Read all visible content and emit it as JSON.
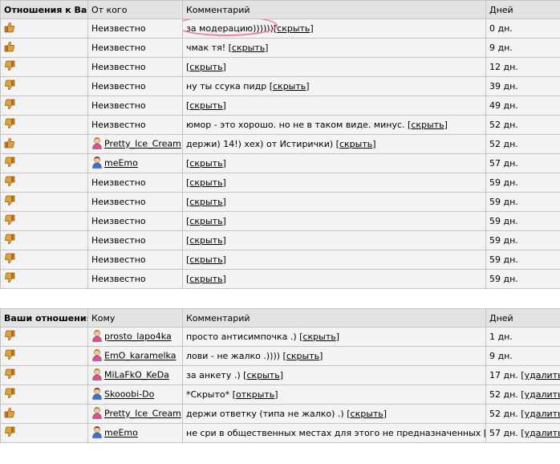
{
  "incoming": {
    "headers": [
      "Отношения к Вам",
      "От кого",
      "Комментарий",
      "Дней"
    ],
    "rows": [
      {
        "vote": "up",
        "from": "Неизвестно",
        "from_user": false,
        "comment": "за модерацию))))))",
        "action": "скрыть",
        "days": "0 дн.",
        "extra": ""
      },
      {
        "vote": "up",
        "from": "Неизвестно",
        "from_user": false,
        "comment": "чмак тя!",
        "action": "скрыть",
        "days": "9 дн.",
        "extra": ""
      },
      {
        "vote": "down",
        "from": "Неизвестно",
        "from_user": false,
        "comment": "",
        "action": "скрыть",
        "days": "12 дн.",
        "extra": ""
      },
      {
        "vote": "down",
        "from": "Неизвестно",
        "from_user": false,
        "comment": "ну ты ссука пидр",
        "action": "скрыть",
        "days": "39 дн.",
        "extra": ""
      },
      {
        "vote": "down",
        "from": "Неизвестно",
        "from_user": false,
        "comment": "",
        "action": "скрыть",
        "days": "49 дн.",
        "extra": ""
      },
      {
        "vote": "down",
        "from": "Неизвестно",
        "from_user": false,
        "comment": "юмор - это хорошо. но не в таком виде. минус.",
        "action": "скрыть",
        "days": "52 дн.",
        "extra": ""
      },
      {
        "vote": "up",
        "from": "Pretty_Ice_Cream",
        "from_user": true,
        "gender": "f",
        "comment": "держи) 14!) хех) от Истирички)",
        "action": "скрыть",
        "days": "52 дн.",
        "extra": ""
      },
      {
        "vote": "down",
        "from": "meEmo",
        "from_user": true,
        "gender": "m",
        "comment": "",
        "action": "скрыть",
        "days": "57 дн.",
        "extra": ""
      },
      {
        "vote": "down",
        "from": "Неизвестно",
        "from_user": false,
        "comment": "",
        "action": "скрыть",
        "days": "59 дн.",
        "extra": ""
      },
      {
        "vote": "down",
        "from": "Неизвестно",
        "from_user": false,
        "comment": "",
        "action": "скрыть",
        "days": "59 дн.",
        "extra": ""
      },
      {
        "vote": "down",
        "from": "Неизвестно",
        "from_user": false,
        "comment": "",
        "action": "скрыть",
        "days": "59 дн.",
        "extra": ""
      },
      {
        "vote": "down",
        "from": "Неизвестно",
        "from_user": false,
        "comment": "",
        "action": "скрыть",
        "days": "59 дн.",
        "extra": ""
      },
      {
        "vote": "down",
        "from": "Неизвестно",
        "from_user": false,
        "comment": "",
        "action": "скрыть",
        "days": "59 дн.",
        "extra": ""
      },
      {
        "vote": "down",
        "from": "Неизвестно",
        "from_user": false,
        "comment": "",
        "action": "скрыть",
        "days": "59 дн.",
        "extra": ""
      }
    ]
  },
  "outgoing": {
    "headers": [
      "Ваши отношения",
      "Кому",
      "Комментарий",
      "Дней"
    ],
    "rows": [
      {
        "vote": "down",
        "from": "prosto_lapo4ka",
        "from_user": true,
        "gender": "f",
        "comment": "просто антисимпочка .)",
        "action": "скрыть",
        "days": "1 дн.",
        "extra": ""
      },
      {
        "vote": "down",
        "from": "EmO_karamelka",
        "from_user": true,
        "gender": "f",
        "comment": "лови - не жалко .))))",
        "action": "скрыть",
        "days": "9 дн.",
        "extra": ""
      },
      {
        "vote": "down",
        "from": "MiLaFkO_KeDa",
        "from_user": true,
        "gender": "f",
        "comment": "за анкету .)",
        "action": "скрыть",
        "days": "17 дн.",
        "extra": "удалить"
      },
      {
        "vote": "down",
        "from": "Skooobi-Do",
        "from_user": true,
        "gender": "m",
        "comment": "*Скрыто*",
        "action": "открыть",
        "days": "52 дн.",
        "extra": "удалить"
      },
      {
        "vote": "up",
        "from": "Pretty_Ice_Cream",
        "from_user": true,
        "gender": "f",
        "comment": "держи ответку (типа не жалко) .)",
        "action": "скрыть",
        "days": "52 дн.",
        "extra": "удалить"
      },
      {
        "vote": "down",
        "from": "meEmo",
        "from_user": true,
        "gender": "m",
        "comment": "не сри в общественных местах для этого не предназначенных",
        "action": "скрыть",
        "days": "57 дн.",
        "extra": "удалить"
      }
    ]
  },
  "colors": {
    "header_bg": "#e3e3e3",
    "row_bg": "#f3f3f3",
    "border": "#c4c4c4",
    "highlight_circle": "#ef7fb0",
    "female": "#e0509a",
    "male": "#3b6fd1",
    "thumb": "#e3a33a"
  }
}
